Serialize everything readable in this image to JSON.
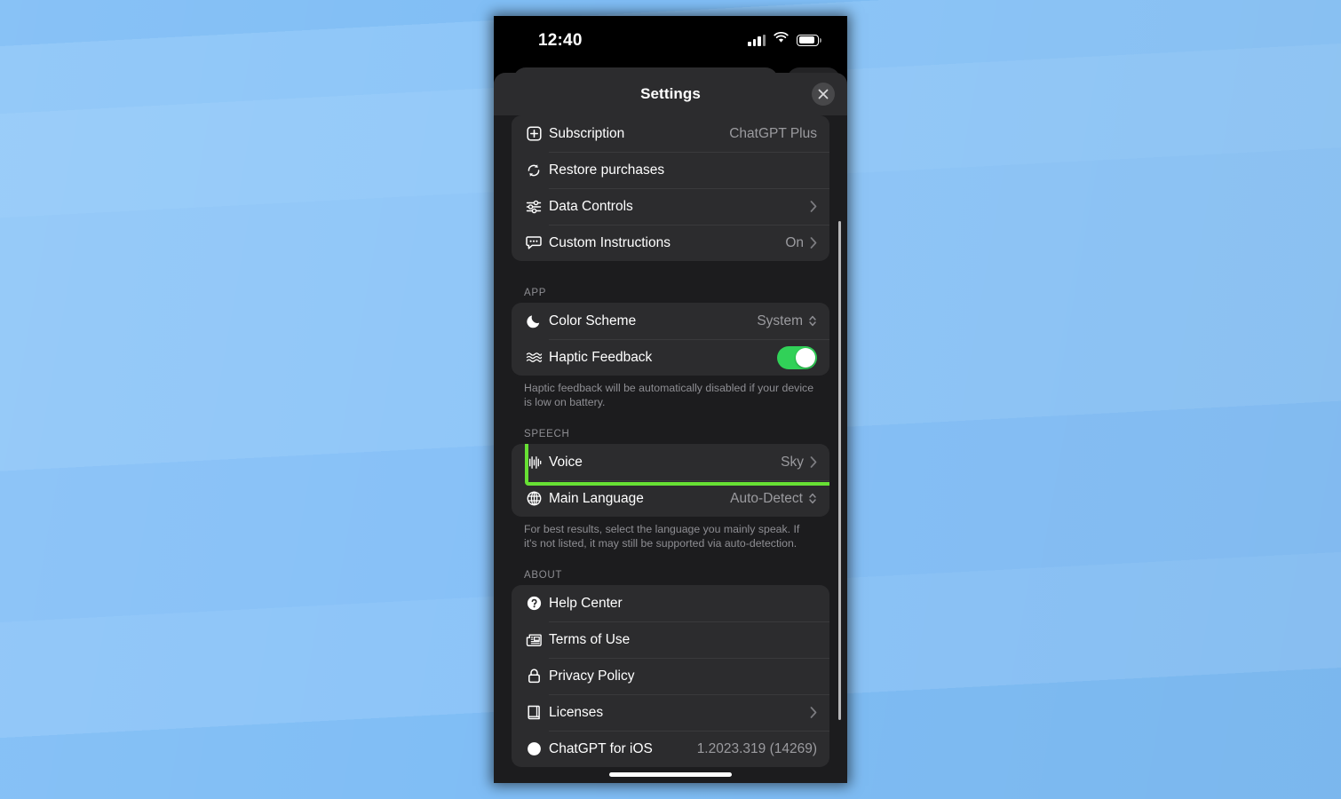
{
  "desktop": {
    "wallpaper_color": "#8ec5f7"
  },
  "phone": {
    "status_bar": {
      "time": "12:40",
      "signal_icon": "cellular-signal-icon",
      "wifi_icon": "wifi-icon",
      "battery_icon": "battery-icon"
    },
    "sheet": {
      "title": "Settings",
      "close_icon": "close-icon"
    },
    "groups": [
      {
        "id": "account",
        "section_label": null,
        "rows": [
          {
            "icon": "plus-square-icon",
            "label": "Subscription",
            "value": "ChatGPT Plus",
            "accessory": "none"
          },
          {
            "icon": "restore-refresh-icon",
            "label": "Restore purchases",
            "value": "",
            "accessory": "none"
          },
          {
            "icon": "sliders-icon",
            "label": "Data Controls",
            "value": "",
            "accessory": "chevron"
          },
          {
            "icon": "speech-bubble-icon",
            "label": "Custom Instructions",
            "value": "On",
            "accessory": "chevron"
          }
        ]
      },
      {
        "id": "app",
        "section_label": "APP",
        "rows": [
          {
            "icon": "moon-icon",
            "label": "Color Scheme",
            "value": "System",
            "accessory": "updown"
          },
          {
            "icon": "haptic-waves-icon",
            "label": "Haptic Feedback",
            "value": "",
            "accessory": "toggle",
            "toggle_on": true
          }
        ],
        "footnote": "Haptic feedback will be automatically disabled if your device is low on battery."
      },
      {
        "id": "speech",
        "section_label": "SPEECH",
        "rows": [
          {
            "icon": "waveform-icon",
            "label": "Voice",
            "value": "Sky",
            "accessory": "chevron",
            "highlighted": true
          },
          {
            "icon": "globe-icon",
            "label": "Main Language",
            "value": "Auto-Detect",
            "accessory": "updown"
          }
        ],
        "footnote": "For best results, select the language you mainly speak. If it's not listed, it may still be supported via auto-detection."
      },
      {
        "id": "about",
        "section_label": "ABOUT",
        "rows": [
          {
            "icon": "question-circle-icon",
            "label": "Help Center",
            "value": "",
            "accessory": "none"
          },
          {
            "icon": "newspaper-icon",
            "label": "Terms of Use",
            "value": "",
            "accessory": "none"
          },
          {
            "icon": "lock-icon",
            "label": "Privacy Policy",
            "value": "",
            "accessory": "none"
          },
          {
            "icon": "book-icon",
            "label": "Licenses",
            "value": "",
            "accessory": "chevron"
          },
          {
            "icon": "app-circle-icon",
            "label": "ChatGPT for iOS",
            "value": "1.2023.319 (14269)",
            "accessory": "none"
          }
        ]
      }
    ],
    "highlight_color": "#67e034",
    "toggle_on_color": "#31d158"
  }
}
